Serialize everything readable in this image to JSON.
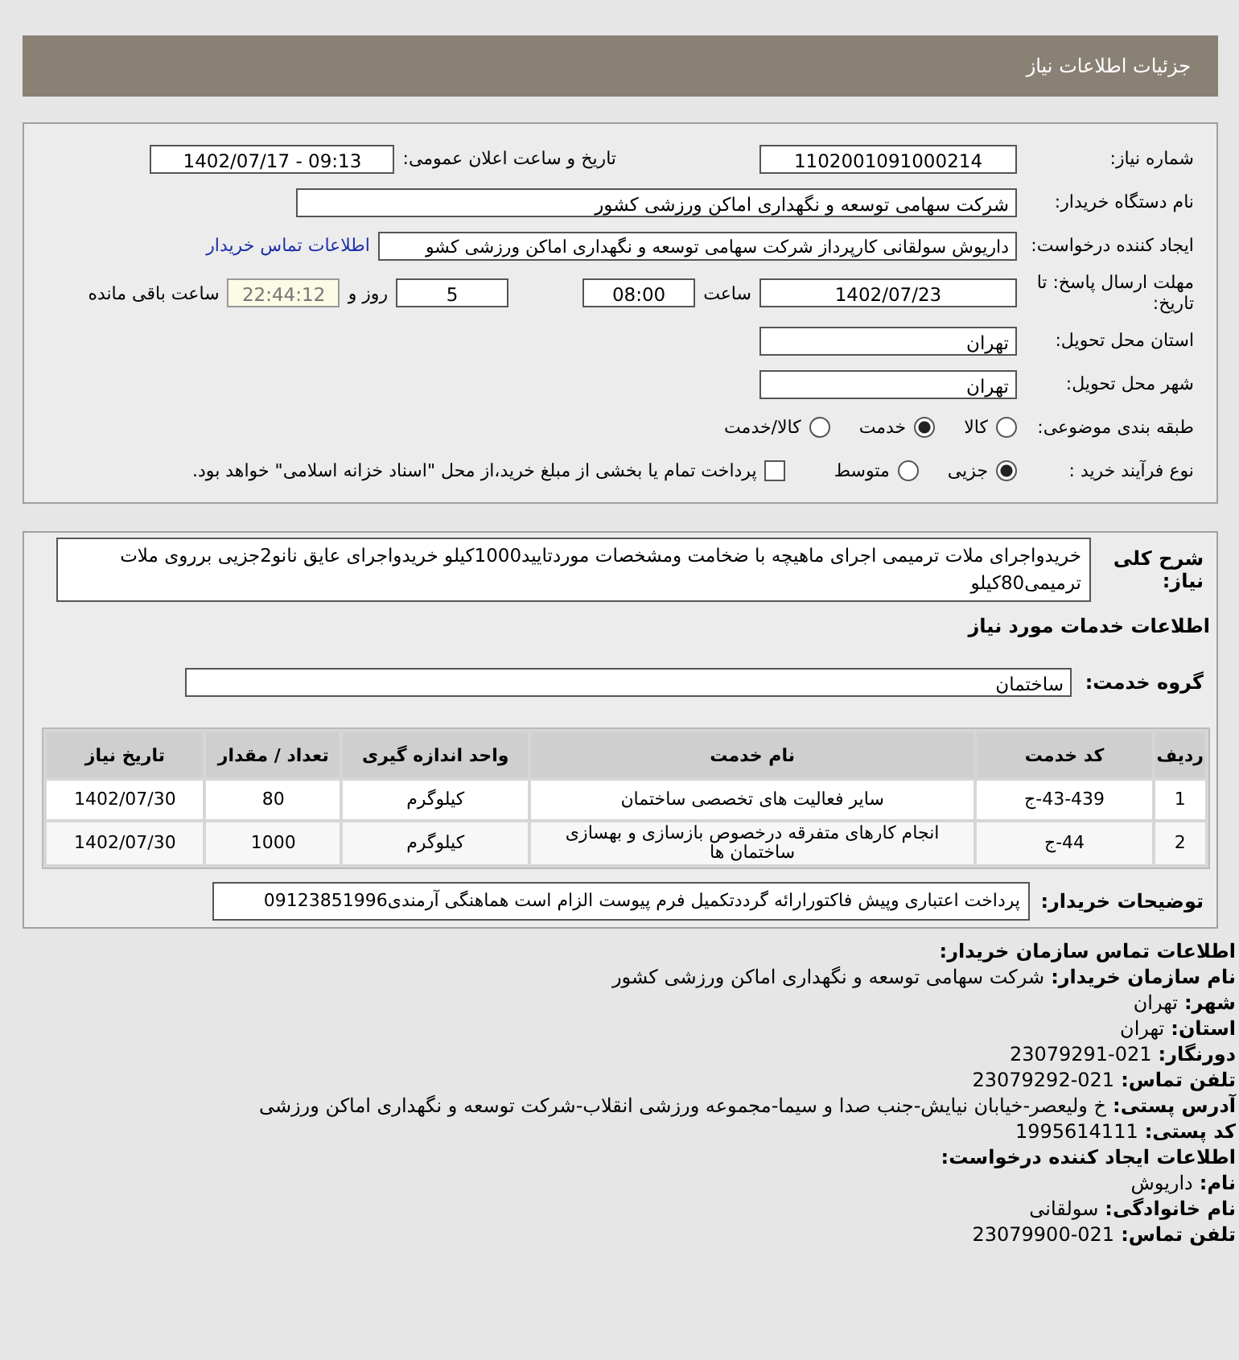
{
  "header": {
    "title": "جزئیات اطلاعات نیاز"
  },
  "summary": {
    "need_number": {
      "label": "شماره نیاز:",
      "value": "1102001091000214"
    },
    "announce_date": {
      "label": "تاریخ و ساعت اعلان عمومی:",
      "value": "1402/07/17 - 09:13"
    },
    "buyer_org": {
      "label": "نام دستگاه خریدار:",
      "value": "شرکت سهامی توسعه و نگهداری اماکن ورزشی کشور"
    },
    "requester": {
      "label": "ایجاد کننده درخواست:",
      "value": "داریوش سولقانی کارپرداز شرکت سهامی توسعه و نگهداری اماکن ورزشی کشو",
      "link": "اطلاعات تماس خریدار"
    },
    "deadline": {
      "label": "مهلت ارسال پاسخ: تا تاریخ:",
      "date": "1402/07/23",
      "time_label": "ساعت",
      "time": "08:00",
      "days": "5",
      "days_label": "روز و",
      "remaining": "22:44:12",
      "remaining_label": "ساعت باقی مانده"
    },
    "province": {
      "label": "استان محل تحویل:",
      "value": "تهران"
    },
    "city": {
      "label": "شهر محل تحویل:",
      "value": "تهران"
    },
    "category": {
      "label": "طبقه بندی موضوعی:",
      "options": [
        {
          "label": "کالا",
          "selected": false
        },
        {
          "label": "خدمت",
          "selected": true
        },
        {
          "label": "کالا/خدمت",
          "selected": false
        }
      ]
    },
    "process": {
      "label": "نوع فرآیند خرید :",
      "options": [
        {
          "label": "جزیی",
          "selected": true
        },
        {
          "label": "متوسط",
          "selected": false
        }
      ],
      "payment": {
        "label": "پرداخت تمام یا بخشی از مبلغ خرید،از محل \"اسناد خزانه اسلامی\" خواهد بود.",
        "checked": false
      }
    }
  },
  "details": {
    "description": {
      "label": "شرح کلی نیاز:",
      "value": "خریدواجرای ملات ترمیمی اجرای ماهیچه با ضخامت ومشخصات موردتایید1000کیلو خریدواجرای عایق نانو2جزیی برروی ملات ترمیمی80کیلو"
    },
    "services_title": "اطلاعات خدمات مورد نیاز",
    "service_group": {
      "label": "گروه خدمت:",
      "value": "ساختمان"
    },
    "table": {
      "columns": [
        "ردیف",
        "کد خدمت",
        "نام خدمت",
        "واحد اندازه گیری",
        "تعداد / مقدار",
        "تاریخ نیاز"
      ],
      "rows": [
        [
          "1",
          "ج-43-439",
          "سایر فعالیت های تخصصی ساختمان",
          "کیلوگرم",
          "80",
          "1402/07/30"
        ],
        [
          "2",
          "ج-44",
          "انجام کارهای متفرقه درخصوص بازسازی و بهسازی ساختمان ها",
          "کیلوگرم",
          "1000",
          "1402/07/30"
        ]
      ]
    },
    "buyer_notes": {
      "label": "توضیحات خریدار:",
      "value": "پرداخت اعتباری وپیش فاکتورارائه گرددتکمیل فرم پیوست الزام است هماهنگی آرمندی09123851996"
    }
  },
  "contact": [
    {
      "kind": "heading",
      "label": "اطلاعات تماس سازمان خریدار:"
    },
    {
      "kind": "field",
      "label": "نام سازمان خریدار:",
      "value": "شرکت سهامی توسعه و نگهداری اماکن ورزشی کشور"
    },
    {
      "kind": "field",
      "label": "شهر:",
      "value": "تهران"
    },
    {
      "kind": "field",
      "label": "استان:",
      "value": "تهران"
    },
    {
      "kind": "field",
      "label": "دورنگار:",
      "value": "23079291-021"
    },
    {
      "kind": "field",
      "label": "تلفن تماس:",
      "value": "23079292-021"
    },
    {
      "kind": "field",
      "label": "آدرس پستی:",
      "value": "خ ولیعصر-خیابان نیایش-جنب صدا و سیما-مجموعه ورزشی انقلاب-شرکت توسعه و نگهداری اماکن ورزشی"
    },
    {
      "kind": "field",
      "label": "کد پستی:",
      "value": "1995614111"
    },
    {
      "kind": "heading",
      "label": "اطلاعات ایجاد کننده درخواست:"
    },
    {
      "kind": "field",
      "label": "نام:",
      "value": "داریوش"
    },
    {
      "kind": "field",
      "label": "نام خانوادگی:",
      "value": "سولقانی"
    },
    {
      "kind": "field",
      "label": "تلفن تماس:",
      "value": "23079900-021"
    }
  ]
}
